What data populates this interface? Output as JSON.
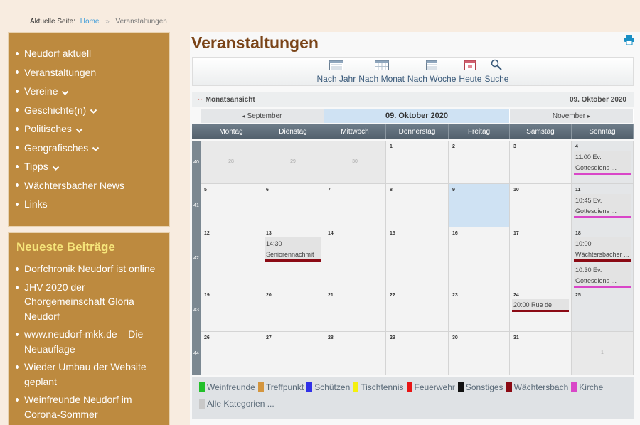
{
  "breadcrumb": {
    "label": "Aktuelle Seite:",
    "home": "Home",
    "sep": "»",
    "current": "Veranstaltungen"
  },
  "menu": [
    {
      "label": "Neudorf aktuell",
      "dropdown": false
    },
    {
      "label": "Veranstaltungen",
      "dropdown": false
    },
    {
      "label": "Vereine",
      "dropdown": true
    },
    {
      "label": "Geschichte(n)",
      "dropdown": true
    },
    {
      "label": "Politisches",
      "dropdown": true
    },
    {
      "label": "Geografisches",
      "dropdown": true
    },
    {
      "label": "Tipps",
      "dropdown": true
    },
    {
      "label": "Wächtersbacher News",
      "dropdown": false
    },
    {
      "label": "Links",
      "dropdown": false
    }
  ],
  "news": {
    "title": "Neueste Beiträge",
    "items": [
      "Dorfchronik Neudorf ist online",
      "JHV 2020 der Chorgemeinschaft Gloria Neudorf",
      "www.neudorf-mkk.de – Die Neuauflage",
      "Wieder Umbau der Website geplant",
      "Weinfreunde Neudorf im Corona-Sommer"
    ]
  },
  "page_title": "Veranstaltungen",
  "toolbar": [
    {
      "label": "Nach Jahr",
      "icon": "calendar-year-icon"
    },
    {
      "label": "Nach Monat",
      "icon": "calendar-month-icon"
    },
    {
      "label": "Nach Woche",
      "icon": "calendar-week-icon"
    },
    {
      "label": "Heute",
      "icon": "calendar-today-icon"
    },
    {
      "label": "Suche",
      "icon": "search-icon"
    }
  ],
  "view": {
    "mode": "Monatsansicht",
    "date": "09. Oktober 2020",
    "dots": "··"
  },
  "nav": {
    "prev": "September",
    "current": "09. Oktober 2020",
    "next": "November"
  },
  "weekdays": [
    "Montag",
    "Dienstag",
    "Mittwoch",
    "Donnerstag",
    "Freitag",
    "Samstag",
    "Sonntag"
  ],
  "weeks": [
    {
      "num": "40",
      "days": [
        {
          "d": "28",
          "other": true
        },
        {
          "d": "29",
          "other": true
        },
        {
          "d": "30",
          "other": true
        },
        {
          "d": "1"
        },
        {
          "d": "2"
        },
        {
          "d": "3"
        },
        {
          "d": "4",
          "events": [
            {
              "text": "11:00 Ev. Gottesdiens ...",
              "color": "#d946c8"
            }
          ]
        }
      ]
    },
    {
      "num": "41",
      "days": [
        {
          "d": "5"
        },
        {
          "d": "6"
        },
        {
          "d": "7"
        },
        {
          "d": "8"
        },
        {
          "d": "9",
          "today": true
        },
        {
          "d": "10"
        },
        {
          "d": "11",
          "events": [
            {
              "text": "10:45 Ev. Gottesdiens ...",
              "color": "#d946c8"
            }
          ]
        }
      ]
    },
    {
      "num": "42",
      "days": [
        {
          "d": "12"
        },
        {
          "d": "13",
          "events": [
            {
              "text": "14:30 Seniorennachmit ...",
              "color": "#8b0a14"
            }
          ]
        },
        {
          "d": "14"
        },
        {
          "d": "15"
        },
        {
          "d": "16"
        },
        {
          "d": "17"
        },
        {
          "d": "18",
          "events": [
            {
              "text": "10:00 Wächtersbacher ...",
              "color": "#8b0a14"
            },
            {
              "text": "10:30 Ev. Gottesdiens ...",
              "color": "#d946c8"
            }
          ]
        }
      ]
    },
    {
      "num": "43",
      "days": [
        {
          "d": "19"
        },
        {
          "d": "20"
        },
        {
          "d": "21"
        },
        {
          "d": "22"
        },
        {
          "d": "23"
        },
        {
          "d": "24",
          "events": [
            {
              "text": "20:00 Rue de Paris",
              "color": "#8b0a14"
            }
          ]
        },
        {
          "d": "25"
        }
      ]
    },
    {
      "num": "44",
      "days": [
        {
          "d": "26"
        },
        {
          "d": "27"
        },
        {
          "d": "28"
        },
        {
          "d": "29"
        },
        {
          "d": "30"
        },
        {
          "d": "31"
        },
        {
          "d": "1",
          "other": true
        }
      ]
    }
  ],
  "legend": [
    {
      "label": "Weinfreunde",
      "color": "#22c02a"
    },
    {
      "label": "Treffpunkt",
      "color": "#d4963f"
    },
    {
      "label": "Schützen",
      "color": "#3131e8"
    },
    {
      "label": "Tischtennis",
      "color": "#f4f00e"
    },
    {
      "label": "Feuerwehr",
      "color": "#e81414"
    },
    {
      "label": "Sonstiges",
      "color": "#111111"
    },
    {
      "label": "Wächtersbach",
      "color": "#8b0a14"
    },
    {
      "label": "Kirche",
      "color": "#d946c8"
    },
    {
      "label": "Alle Kategorien ...",
      "color": "#c8c8c8"
    }
  ],
  "colors": {
    "title": "#7a4418",
    "sidebar": "#bd8a3f",
    "news_title": "#f6e57a",
    "link": "#3a9ad9",
    "print": "#1a8fc4"
  }
}
